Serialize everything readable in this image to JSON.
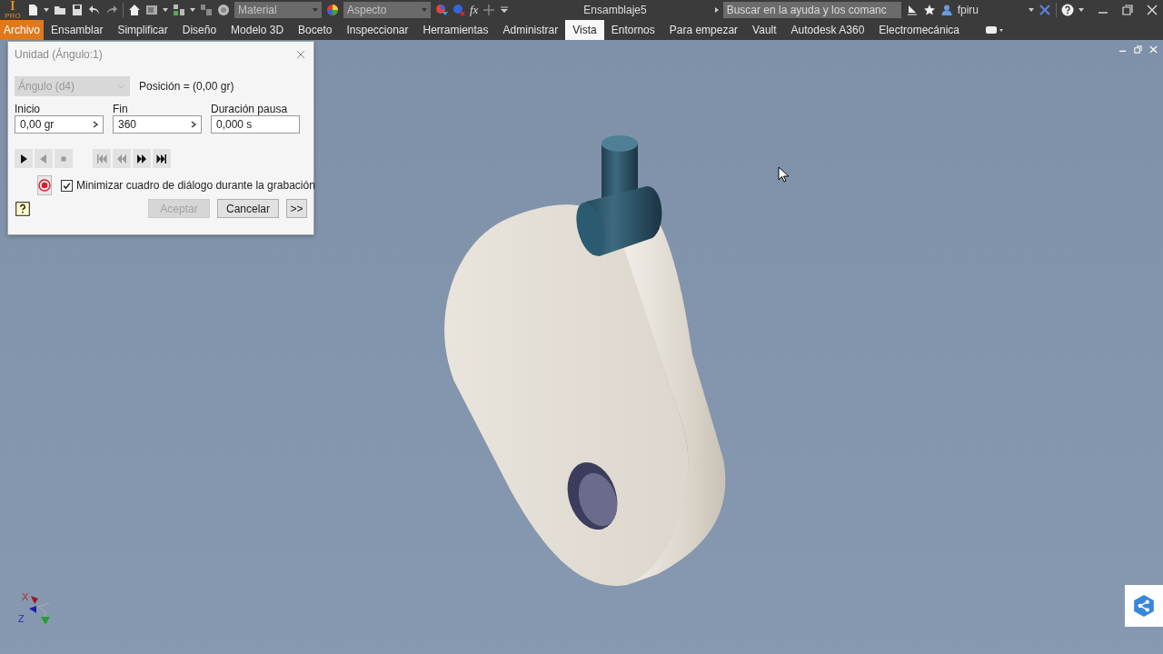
{
  "toolbar": {
    "logo": {
      "letter": "I",
      "edition": "PRO"
    },
    "material": {
      "placeholder": "Material",
      "disabled": true
    },
    "appearance": {
      "placeholder": "Aspecto",
      "disabled": true
    },
    "formula": "fx",
    "document_title": "Ensamblaje5",
    "search": {
      "placeholder": "Buscar en la ayuda y los comanc"
    },
    "user": "fpiru"
  },
  "ribbon_tabs": [
    {
      "label": "Archivo",
      "kind": "file",
      "selected": false
    },
    {
      "label": "Ensamblar",
      "kind": "tab",
      "selected": false
    },
    {
      "label": "Simplificar",
      "kind": "tab",
      "selected": false
    },
    {
      "label": "Diseño",
      "kind": "tab",
      "selected": false
    },
    {
      "label": "Modelo 3D",
      "kind": "tab",
      "selected": false
    },
    {
      "label": "Boceto",
      "kind": "tab",
      "selected": false
    },
    {
      "label": "Inspeccionar",
      "kind": "tab",
      "selected": false
    },
    {
      "label": "Herramientas",
      "kind": "tab",
      "selected": false
    },
    {
      "label": "Administrar",
      "kind": "tab",
      "selected": false
    },
    {
      "label": "Vista",
      "kind": "tab",
      "selected": true
    },
    {
      "label": "Entornos",
      "kind": "tab",
      "selected": false
    },
    {
      "label": "Para empezar",
      "kind": "tab",
      "selected": false
    },
    {
      "label": "Vault",
      "kind": "tab",
      "selected": false
    },
    {
      "label": "Autodesk A360",
      "kind": "tab",
      "selected": false
    },
    {
      "label": "Electromecánica",
      "kind": "tab",
      "selected": false
    }
  ],
  "dialog": {
    "title": "Unidad (Ángulo:1)",
    "parameter": {
      "value": "Ángulo (d4)",
      "disabled": true
    },
    "position": "Posición = (0,00 gr)",
    "fields": [
      {
        "label": "Inicio",
        "value": "0,00 gr",
        "kind": "stepper"
      },
      {
        "label": "Fin",
        "value": "360",
        "kind": "stepper"
      },
      {
        "label": "Duración pausa",
        "value": "0,000 s",
        "kind": "plain"
      }
    ],
    "playback": [
      {
        "kind": "play",
        "disabled": false
      },
      {
        "kind": "reverse",
        "disabled": true
      },
      {
        "kind": "stop",
        "disabled": true
      },
      {
        "kind": "first",
        "disabled": true
      },
      {
        "kind": "back",
        "disabled": true
      },
      {
        "kind": "forward",
        "disabled": false
      },
      {
        "kind": "last",
        "disabled": false
      }
    ],
    "minimize_checkbox": {
      "label": "Minimizar cuadro de diálogo durante la grabación",
      "checked": true
    },
    "buttons": [
      {
        "label": "Aceptar",
        "kind": "ok",
        "disabled": true
      },
      {
        "label": "Cancelar",
        "kind": "cancel",
        "disabled": false
      },
      {
        "label": ">>",
        "kind": "more",
        "disabled": false
      }
    ]
  },
  "viewport": {
    "triad": {
      "x_label": "X",
      "z_label": "Z"
    }
  }
}
